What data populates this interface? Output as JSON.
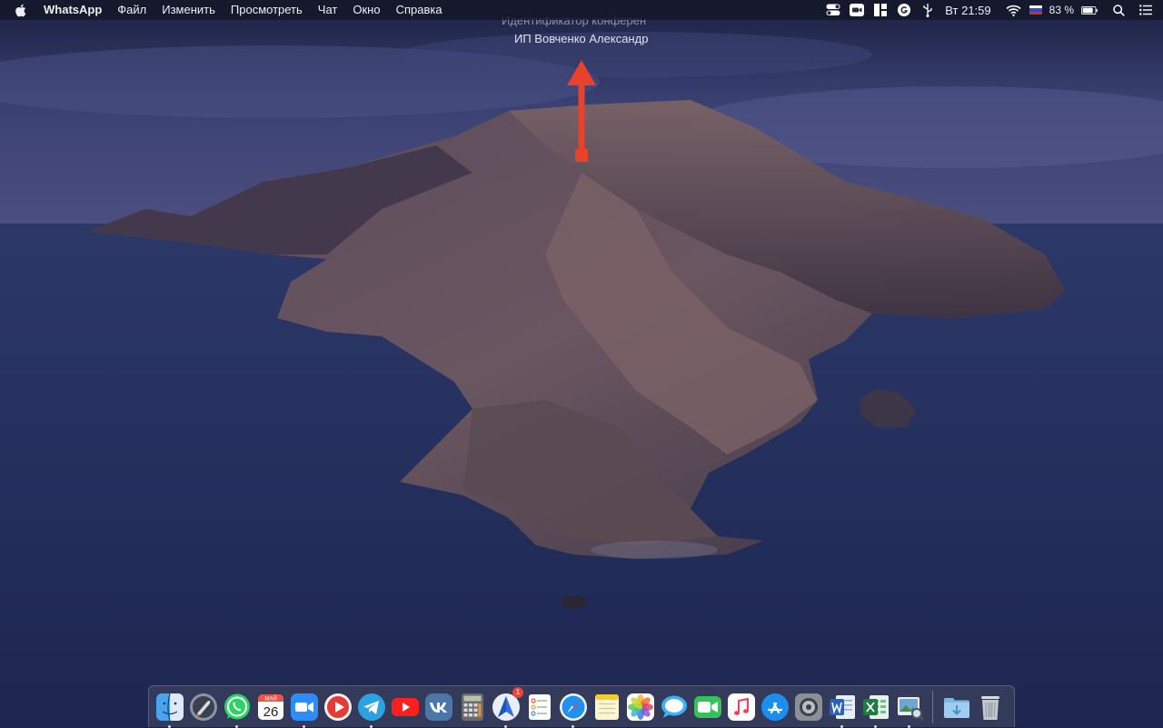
{
  "menubar": {
    "app_name": "WhatsApp",
    "menus": [
      "Файл",
      "Изменить",
      "Просмотреть",
      "Чат",
      "Окно",
      "Справка"
    ],
    "clock": "Вт 21:59",
    "battery_percent": "83 %",
    "status_icons": [
      "zoom-toggle-icon",
      "zoom-camera-icon",
      "window-manager-icon",
      "grammarly-icon",
      "usb-icon",
      "wifi-icon",
      "russian-flag-input-icon",
      "battery-icon",
      "spotlight-search-icon",
      "notification-center-icon"
    ]
  },
  "overlay": {
    "line1": "Идентификатор конферен",
    "line2": "ИП Вовченко Александр"
  },
  "dock": {
    "calendar_month": "МАЙ",
    "calendar_day": "26",
    "safari_alt_badge": "1",
    "apps": [
      {
        "name": "Finder",
        "icon": "finder-icon",
        "running": true
      },
      {
        "name": "Launchpad",
        "icon": "launchpad-icon",
        "running": false
      },
      {
        "name": "WhatsApp",
        "icon": "whatsapp-icon",
        "running": true
      },
      {
        "name": "Календарь",
        "icon": "calendar-icon",
        "running": false
      },
      {
        "name": "Zoom",
        "icon": "zoom-icon",
        "running": true
      },
      {
        "name": "Player",
        "icon": "play-icon",
        "running": false
      },
      {
        "name": "Telegram",
        "icon": "telegram-icon",
        "running": true
      },
      {
        "name": "YouTube",
        "icon": "youtube-icon",
        "running": false
      },
      {
        "name": "VK",
        "icon": "vk-icon",
        "running": false
      },
      {
        "name": "Calculator",
        "icon": "calculator-icon",
        "running": false
      },
      {
        "name": "Spark",
        "icon": "spark-mail-icon",
        "running": true
      },
      {
        "name": "Reminders",
        "icon": "reminders-icon",
        "running": false
      },
      {
        "name": "Safari",
        "icon": "safari-icon",
        "running": true
      },
      {
        "name": "Notes",
        "icon": "notes-icon",
        "running": false
      },
      {
        "name": "Photos",
        "icon": "photos-icon",
        "running": false
      },
      {
        "name": "Messages",
        "icon": "messages-icon",
        "running": false
      },
      {
        "name": "FaceTime",
        "icon": "facetime-icon",
        "running": false
      },
      {
        "name": "Music",
        "icon": "music-icon",
        "running": false
      },
      {
        "name": "App Store",
        "icon": "app-store-icon",
        "running": false
      },
      {
        "name": "System Preferences",
        "icon": "system-preferences-icon",
        "running": false
      },
      {
        "name": "Word",
        "icon": "word-icon",
        "running": true
      },
      {
        "name": "Excel",
        "icon": "excel-icon",
        "running": true
      },
      {
        "name": "Preview",
        "icon": "preview-icon",
        "running": true
      }
    ],
    "trailing": [
      "downloads-folder-icon",
      "trash-icon"
    ]
  },
  "colors": {
    "arrow": "#e8412c",
    "sky_top": "#1c2240",
    "sea": "#24305a"
  }
}
